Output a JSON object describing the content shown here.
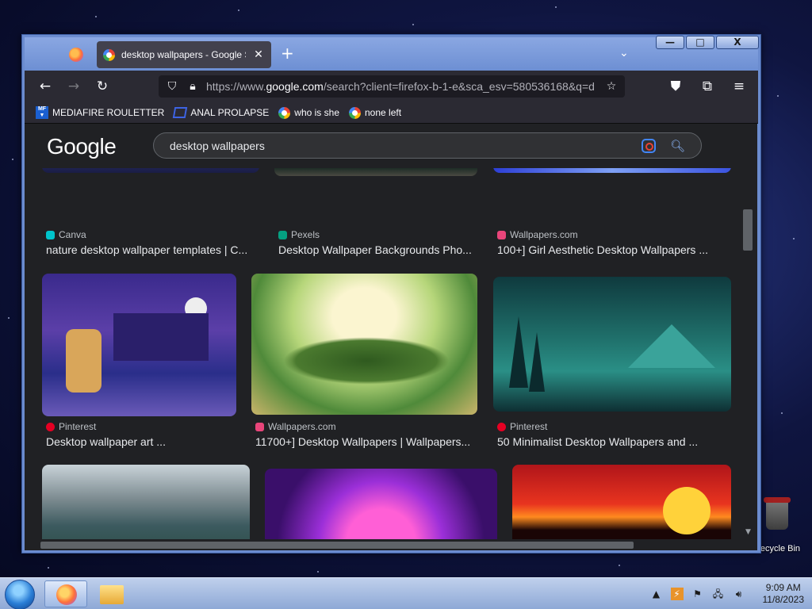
{
  "desktop": {
    "recycle_bin_label": "Recycle Bin"
  },
  "browser": {
    "tab": {
      "title": "desktop wallpapers - Google Search",
      "close_glyph": "✕"
    },
    "new_tab_glyph": "+",
    "list_tabs_glyph": "⌄",
    "window_buttons": {
      "minimize": "—",
      "maximize": "□",
      "close": "X"
    },
    "url": {
      "prefix": "https://www.",
      "domain": "google.com",
      "rest": "/search?client=firefox-b-1-e&sca_esv=580536168&q=d"
    },
    "bookmarks": [
      {
        "label": "MEDIAFIRE ROULETTER",
        "icon": "mediafire-icon"
      },
      {
        "label": "ANAL PROLAPSE",
        "icon": "bookmark-icon"
      },
      {
        "label": "who is she",
        "icon": "google-icon"
      },
      {
        "label": "none left",
        "icon": "google-icon"
      }
    ]
  },
  "google": {
    "logo": "Google",
    "query": "desktop wallpapers",
    "results_row1": [
      {
        "source": "Canva",
        "caption": "nature desktop wallpaper templates | C...",
        "fav_color": "#00c4cc"
      },
      {
        "source": "Pexels",
        "caption": "Desktop Wallpaper Backgrounds Pho...",
        "fav_color": "#05a081"
      },
      {
        "source": "Wallpapers.com",
        "caption": "100+] Girl Aesthetic Desktop Wallpapers ...",
        "fav_color": "#e8457a"
      }
    ],
    "results_row2": [
      {
        "source": "Pinterest",
        "caption": "Desktop wallpaper art ...",
        "fav_color": "#e60023"
      },
      {
        "source": "Wallpapers.com",
        "caption": "11700+] Desktop Wallpapers | Wallpapers...",
        "fav_color": "#e8457a"
      },
      {
        "source": "Pinterest",
        "caption": "50 Minimalist Desktop Wallpapers and ...",
        "fav_color": "#e60023"
      }
    ]
  },
  "taskbar": {
    "time": "9:09 AM",
    "date": "11/8/2023"
  }
}
